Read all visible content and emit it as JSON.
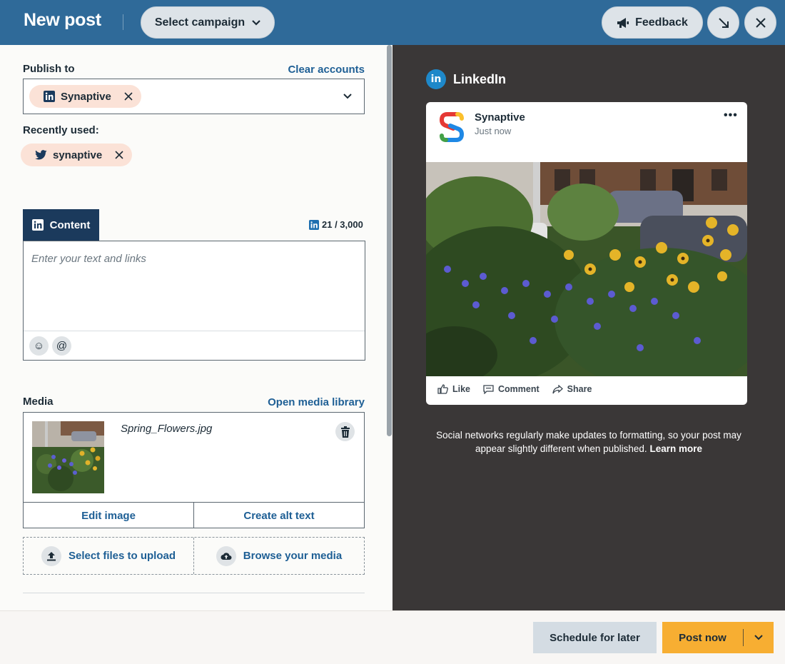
{
  "header": {
    "title": "New post",
    "campaign_label": "Select campaign",
    "feedback_label": "Feedback"
  },
  "publish": {
    "label": "Publish to",
    "clear_label": "Clear accounts",
    "selected_account": "Synaptive",
    "recent_label": "Recently used:",
    "recent_account": "synaptive"
  },
  "content": {
    "tab_label": "Content",
    "counter": "21 / 3,000",
    "placeholder": "Enter your text and links",
    "emoji_symbol": "☺",
    "mention_symbol": "@"
  },
  "media": {
    "label": "Media",
    "library_label": "Open media library",
    "filename": "Spring_Flowers.jpg",
    "edit_label": "Edit image",
    "alt_label": "Create alt text",
    "upload_label": "Select files to upload",
    "browse_label": "Browse your media"
  },
  "preview": {
    "network": "LinkedIn",
    "network_logo": "in",
    "account_name": "Synaptive",
    "time": "Just now",
    "more": "•••",
    "like": "Like",
    "comment": "Comment",
    "share": "Share",
    "disclaimer": "Social networks regularly make updates to formatting, so your post may appear slightly different when published.",
    "learn_more": "Learn more"
  },
  "footer": {
    "schedule_label": "Schedule for later",
    "post_label": "Post now"
  },
  "colors": {
    "header_bg": "#2f6a99",
    "accent_link": "#1e5f95",
    "post_button": "#f7ae32",
    "preview_bg": "#3a3737",
    "chip_bg": "#fbe2d7"
  }
}
